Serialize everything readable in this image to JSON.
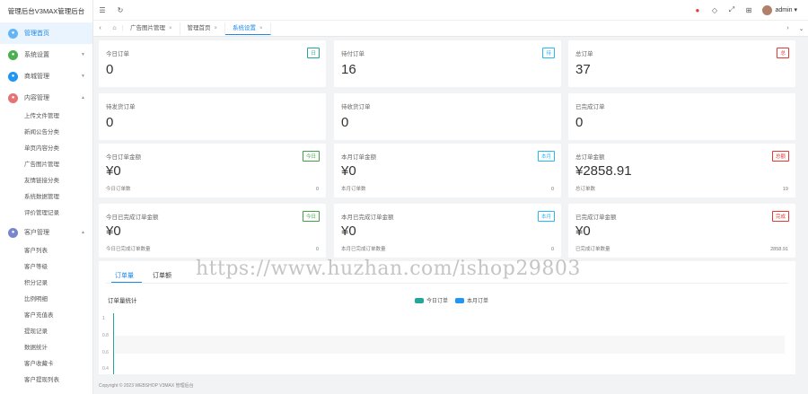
{
  "brand": "管理后台V3MAX管理后台",
  "menu": [
    {
      "label": "管理首页",
      "icon": "home-icon",
      "color": "#64b5f6",
      "active": true
    },
    {
      "label": "系统设置",
      "icon": "settings-icon",
      "color": "#4caf50",
      "arrow": "▼"
    },
    {
      "label": "商城管理",
      "icon": "shop-icon",
      "color": "#2196f3",
      "arrow": "▼"
    },
    {
      "label": "内容管理",
      "icon": "content-icon",
      "color": "#e57373",
      "arrow": "▲"
    }
  ],
  "content_sub": [
    "上传文件管理",
    "新闻公告分类",
    "单页内容分类",
    "广告图片管理",
    "友情链接分类",
    "系统数据管理",
    "评价管理记录"
  ],
  "menu2": {
    "label": "客户管理",
    "color": "#7986cb",
    "arrow": "▲"
  },
  "customer_sub": [
    "客户列表",
    "客户等级",
    "积分记录",
    "比例明细",
    "客户充值表",
    "提现记录",
    "数据统计",
    "客户收藏卡",
    "客户提现列表"
  ],
  "topbar": {
    "menu_icon": "☰",
    "refresh_icon": "↻",
    "user": "admin ▾",
    "right_icons": [
      "●",
      "◇",
      "⤢",
      "⊞"
    ]
  },
  "tabs": [
    "广告图片管理",
    "管理首页",
    "系统设置"
  ],
  "cards": [
    {
      "label": "今日订单",
      "value": "0",
      "badge": "日",
      "badge_color": "#26a69a"
    },
    {
      "label": "待付订单",
      "value": "16",
      "badge": "待",
      "badge_color": "#29b6f6"
    },
    {
      "label": "总订单",
      "value": "37",
      "badge": "总",
      "badge_color": "#e53935"
    },
    {
      "label": "待发货订单",
      "value": "0"
    },
    {
      "label": "待收货订单",
      "value": "0"
    },
    {
      "label": "已完成订单",
      "value": "0"
    },
    {
      "label": "今日订单金额",
      "value": "¥0",
      "badge": "今日",
      "badge_color": "#43a047",
      "foot_l": "今日订单数",
      "foot_r": "0"
    },
    {
      "label": "本月订单金额",
      "value": "¥0",
      "badge": "本月",
      "badge_color": "#29b6f6",
      "foot_l": "本月订单数",
      "foot_r": "0"
    },
    {
      "label": "总订单金额",
      "value": "¥2858.91",
      "badge": "总额",
      "badge_color": "#e53935",
      "foot_l": "总订单数",
      "foot_r": "19"
    },
    {
      "label": "今日已完成订单金额",
      "value": "¥0",
      "badge": "今日",
      "badge_color": "#43a047",
      "foot_l": "今日已完成订单数量",
      "foot_r": "0"
    },
    {
      "label": "本月已完成订单金额",
      "value": "¥0",
      "badge": "本月",
      "badge_color": "#29b6f6",
      "foot_l": "本月已完成订单数量",
      "foot_r": "0"
    },
    {
      "label": "已完成订单金额",
      "value": "¥0",
      "badge": "完成",
      "badge_color": "#e53935",
      "foot_l": "已完成订单数量",
      "foot_r": "2858.91"
    }
  ],
  "chart_panel": {
    "tabs": [
      "订单量",
      "订单额"
    ],
    "title": "订单量统计",
    "legend": [
      {
        "name": "今日订单",
        "color": "#26a69a"
      },
      {
        "name": "本月订单",
        "color": "#2196f3"
      }
    ]
  },
  "chart_data": {
    "type": "line",
    "title": "订单量统计",
    "series": [
      {
        "name": "今日订单",
        "values": []
      },
      {
        "name": "本月订单",
        "values": []
      }
    ],
    "yticks": [
      "1",
      "0.8",
      "0.6",
      "0.4"
    ]
  },
  "footer": "Copyright © 2023 WEBSHOP V3MAX 管理后台",
  "watermark": "https://www.huzhan.com/ishop29803"
}
